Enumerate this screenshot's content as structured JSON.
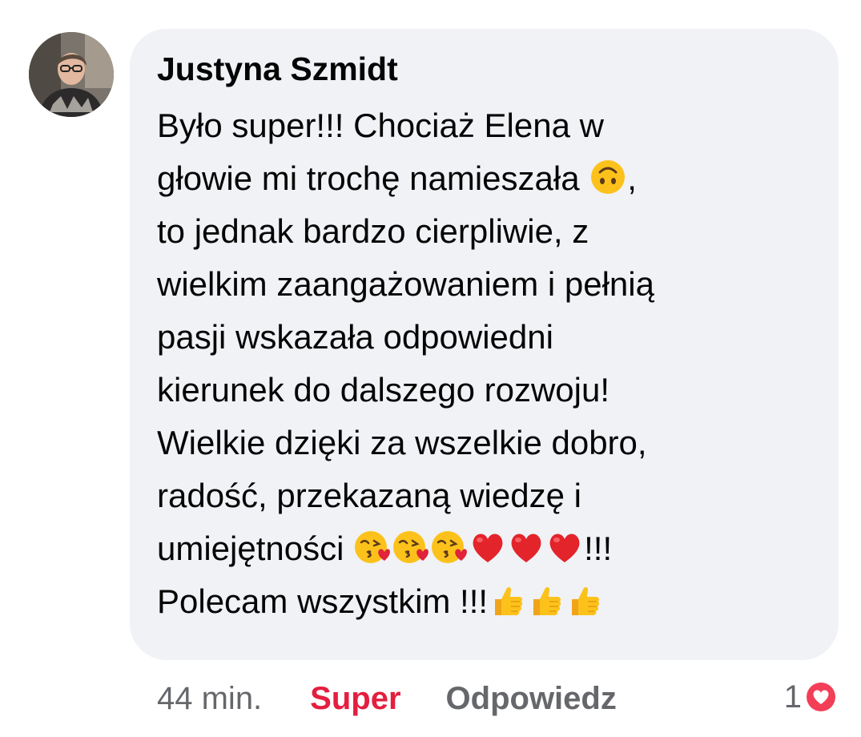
{
  "comment": {
    "author": "Justyna Szmidt",
    "avatar_icon": "user-photo-avatar",
    "lines": [
      [
        {
          "t": "Było super!!! Chociaż Elena w"
        }
      ],
      [
        {
          "t": "głowie mi trochę namieszała "
        },
        {
          "e": "upside-down-face"
        },
        {
          "t": ","
        }
      ],
      [
        {
          "t": "to jednak bardzo cierpliwie, z"
        }
      ],
      [
        {
          "t": "wielkim zaangażowaniem i pełnią"
        }
      ],
      [
        {
          "t": "pasji wskazała odpowiedni"
        }
      ],
      [
        {
          "t": "kierunek do dalszego rozwoju!"
        }
      ],
      [
        {
          "t": "Wielkie dzięki za wszelkie dobro,"
        }
      ],
      [
        {
          "t": "radość, przekazaną wiedzę i"
        }
      ],
      [
        {
          "t": "umiejętności "
        },
        {
          "e": "face-blowing-kiss"
        },
        {
          "e": "face-blowing-kiss"
        },
        {
          "e": "face-blowing-kiss"
        },
        {
          "e": "red-heart"
        },
        {
          "e": "red-heart"
        },
        {
          "e": "red-heart"
        },
        {
          "t": "!!!"
        }
      ],
      [
        {
          "t": "Polecam wszystkim !!!"
        },
        {
          "e": "thumbs-up"
        },
        {
          "e": "thumbs-up"
        },
        {
          "e": "thumbs-up"
        }
      ]
    ]
  },
  "actions": {
    "time": "44 min.",
    "like_label": "Super",
    "reply_label": "Odpowiedz"
  },
  "reactions": {
    "count": "1",
    "icon": "heart-reaction-icon"
  },
  "colors": {
    "bubble": "#f0f2f5",
    "like_active": "#e41e3f",
    "muted": "#65676b",
    "text": "#050505"
  }
}
